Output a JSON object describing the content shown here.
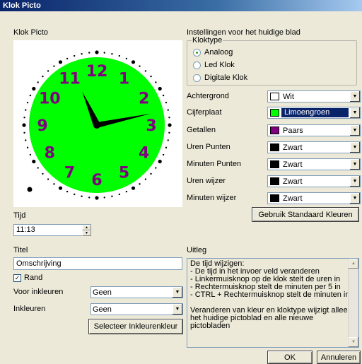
{
  "window": {
    "title": "Klok Picto"
  },
  "left": {
    "clock_label": "Klok Picto",
    "clock": {
      "face_color": "#00ff00",
      "numeral_color": "#800080",
      "hand_color": "#000000",
      "hours": 11,
      "minutes": 13,
      "numerals": [
        "12",
        "1",
        "2",
        "3",
        "4",
        "5",
        "6",
        "7",
        "8",
        "9",
        "10",
        "11"
      ]
    },
    "time_label": "Tijd",
    "time_value": "11:13",
    "title_label": "Titel",
    "title_value": "Omschrijving",
    "border_checkbox_label": "Rand",
    "border_checked": true,
    "foreground_fill_label": "Voor inkleuren",
    "foreground_fill_value": "Geen",
    "fill_label": "Inkleuren",
    "fill_value": "Geen",
    "select_fill_button": "Selecteer Inkleurenkleur"
  },
  "right": {
    "settings_label": "Instellingen voor het huidige blad",
    "clock_type": {
      "legend": "Kloktype",
      "options": [
        "Analoog",
        "Led Klok",
        "Digitale Klok"
      ],
      "selected": "Analoog"
    },
    "colors": [
      {
        "label": "Achtergrond",
        "value": "Wit",
        "swatch": "#ffffff"
      },
      {
        "label": "Cijferplaat",
        "value": "Limoengroen",
        "swatch": "#00ff00"
      },
      {
        "label": "Getallen",
        "value": "Paars",
        "swatch": "#800080"
      },
      {
        "label": "Uren Punten",
        "value": "Zwart",
        "swatch": "#000000"
      },
      {
        "label": "Minuten Punten",
        "value": "Zwart",
        "swatch": "#000000"
      },
      {
        "label": "Uren wijzer",
        "value": "Zwart",
        "swatch": "#000000"
      },
      {
        "label": "Minuten wijzer",
        "value": "Zwart",
        "swatch": "#000000"
      }
    ],
    "default_colors_button": "Gebruik Standaard Kleuren",
    "explanation_label": "Uitleg",
    "explanation_lines": [
      "De tijd wijzigen:",
      "- De tijd in het invoer veld veranderen",
      "- Linkermuisknop op de klok stelt de uren in",
      "- Rechtermuisknop stelt de minuten per 5 in",
      "- CTRL + Rechtermuisknop stelt de minuten in",
      "",
      "Veranderen van kleur en kloktype wijzigt alleen",
      "het huidige pictoblad en alle nieuwe",
      "pictobladen"
    ]
  },
  "footer": {
    "ok_button": "OK",
    "cancel_button": "Annuleren"
  }
}
